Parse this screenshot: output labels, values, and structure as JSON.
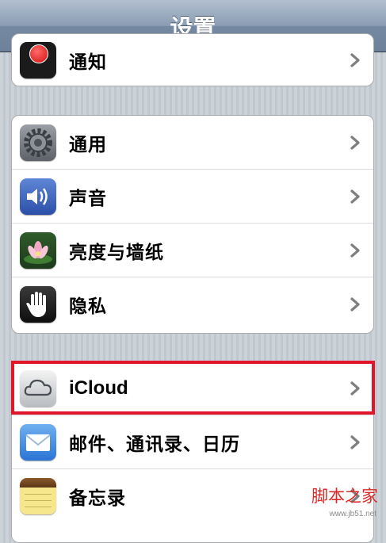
{
  "header": {
    "title": "设置"
  },
  "groups": [
    {
      "items": [
        {
          "label": "通知",
          "icon": "notifications-icon"
        }
      ]
    },
    {
      "items": [
        {
          "label": "通用",
          "icon": "gear-icon"
        },
        {
          "label": "声音",
          "icon": "speaker-icon"
        },
        {
          "label": "亮度与墙纸",
          "icon": "flower-wallpaper-icon"
        },
        {
          "label": "隐私",
          "icon": "hand-icon"
        }
      ]
    },
    {
      "items": [
        {
          "label": "iCloud",
          "icon": "cloud-icon"
        },
        {
          "label": "邮件、通讯录、日历",
          "icon": "mail-envelope-icon"
        },
        {
          "label": "备忘录",
          "icon": "notepad-icon"
        }
      ]
    }
  ],
  "highlight": {
    "color": "#e2162a",
    "target": "iCloud"
  },
  "watermark": {
    "main": "脚本之家",
    "sub": "www.jb51.net"
  }
}
